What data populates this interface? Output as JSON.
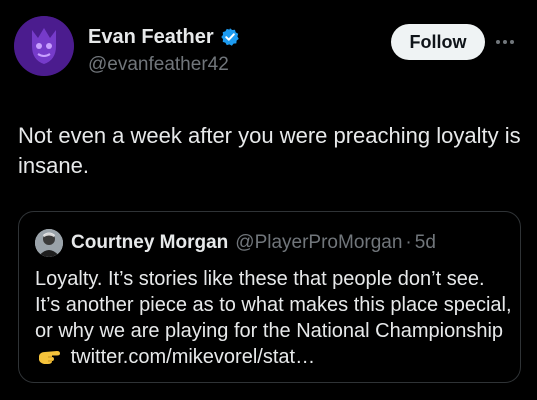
{
  "author": {
    "display_name": "Evan Feather",
    "handle": "@evanfeather42",
    "verified_icon": "verified-badge-icon",
    "avatar_icon": "purple-mascot-avatar"
  },
  "actions": {
    "follow_label": "Follow",
    "more_icon": "more-dots-icon"
  },
  "tweet": {
    "text": "Not even a week after you were preaching loyalty is insane."
  },
  "quote": {
    "display_name": "Courtney Morgan",
    "handle": "@PlayerProMorgan",
    "separator": "·",
    "time": "5d",
    "body_before_icon": "Loyalty. It’s stories like these that people don’t see. It’s another piece as to what makes this place special, or why we are playing for the National Championship",
    "icon": "pointing-hand-emoji",
    "link": "twitter.com/mikevorel/stat…"
  },
  "colors": {
    "background": "#000000",
    "text": "#e7e9ea",
    "muted": "#71767b",
    "verified": "#1d9bf0",
    "border": "#2f3336"
  }
}
